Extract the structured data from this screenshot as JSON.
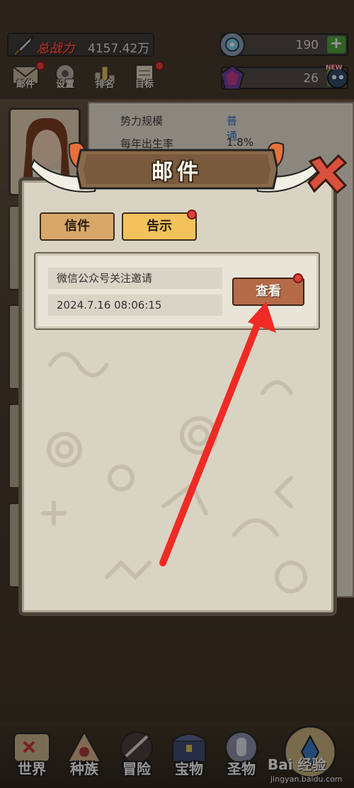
{
  "hud": {
    "power_label": "总战力",
    "power_value": "4157.42万",
    "resource_1": {
      "icon": "gear-crystal-icon",
      "value": "190"
    },
    "resource_2": {
      "icon": "purple-gem-icon",
      "value": "26"
    },
    "plus_label": "+",
    "new_tag": "NEW"
  },
  "menu": [
    {
      "label": "邮件",
      "icon": "mail-icon",
      "has_dot": true
    },
    {
      "label": "设置",
      "icon": "gear-icon",
      "has_dot": false
    },
    {
      "label": "排名",
      "icon": "ranking-icon",
      "has_dot": false
    },
    {
      "label": "目标",
      "icon": "scroll-icon",
      "has_dot": true
    }
  ],
  "background_panel": {
    "row1_key": "势力规模",
    "row1_value": "普通",
    "row2_key": "每年出生率",
    "row2_value": "1.8%"
  },
  "dialog": {
    "title": "邮件",
    "tabs": [
      {
        "label": "信件",
        "active": false
      },
      {
        "label": "告示",
        "active": true,
        "has_dot": true
      }
    ],
    "mail": {
      "subject": "微信公众号关注邀请",
      "time": "2024.7.16  08:06:15",
      "view_label": "查看"
    }
  },
  "bottom_nav": [
    {
      "label": "世界",
      "icon": "world-icon"
    },
    {
      "label": "种族",
      "icon": "tribe-icon"
    },
    {
      "label": "冒险",
      "icon": "adventure-icon"
    },
    {
      "label": "宝物",
      "icon": "treasure-chest-icon"
    },
    {
      "label": "圣物",
      "icon": "relic-hand-icon"
    }
  ],
  "watermark": {
    "text": "Bai 经验",
    "url": "jingyan.baidu.com"
  },
  "colors": {
    "accent_red": "#e1403a",
    "link_blue": "#2d6fc6",
    "plus_green": "#4fa43a",
    "plank": "#b56a48"
  }
}
